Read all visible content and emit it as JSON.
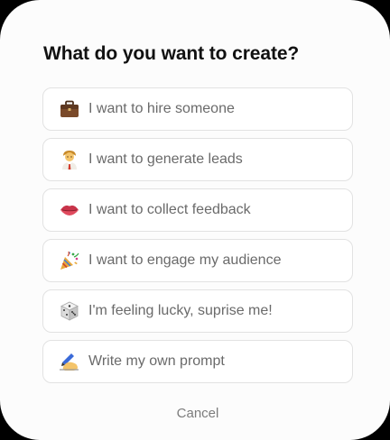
{
  "dialog": {
    "title": "What do you want to create?",
    "options": [
      {
        "icon": "briefcase-icon",
        "label": "I want to hire someone"
      },
      {
        "icon": "man-office-worker-icon",
        "label": "I want to generate leads"
      },
      {
        "icon": "lips-icon",
        "label": "I want to collect feedback"
      },
      {
        "icon": "party-popper-icon",
        "label": "I want to engage my audience"
      },
      {
        "icon": "game-die-icon",
        "label": "I'm feeling lucky, suprise me!"
      },
      {
        "icon": "writing-hand-icon",
        "label": "Write my own prompt"
      }
    ],
    "cancel_label": "Cancel"
  }
}
